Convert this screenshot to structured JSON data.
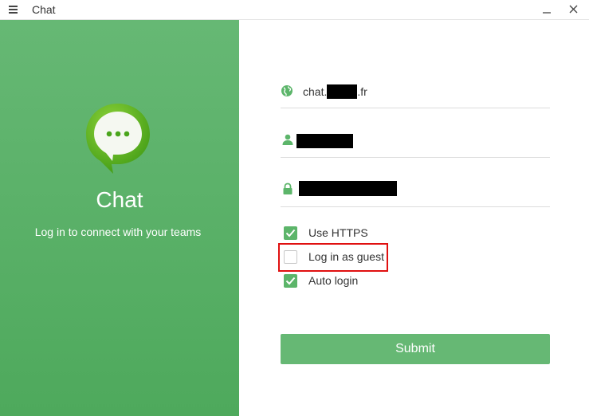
{
  "window": {
    "title": "Chat",
    "menu_icon": "hamburger-menu-icon",
    "minimize_icon": "minimize-icon",
    "close_icon": "close-icon"
  },
  "brand": {
    "name": "Chat",
    "tagline": "Log in to connect with your teams",
    "logo_icon": "chat-bubble-icon",
    "panel_color": "#5cb56a"
  },
  "form": {
    "server": {
      "prefix": "chat.",
      "suffix": ".fr",
      "icon": "globe-icon"
    },
    "username": {
      "icon": "user-icon"
    },
    "password": {
      "icon": "lock-icon"
    },
    "options": [
      {
        "label": "Use HTTPS",
        "checked": true
      },
      {
        "label": "Log in as guest",
        "checked": false
      },
      {
        "label": "Auto login",
        "checked": true
      }
    ],
    "submit_label": "Submit"
  },
  "colors": {
    "accent": "#5cb56a",
    "highlight_border": "#e01010"
  }
}
